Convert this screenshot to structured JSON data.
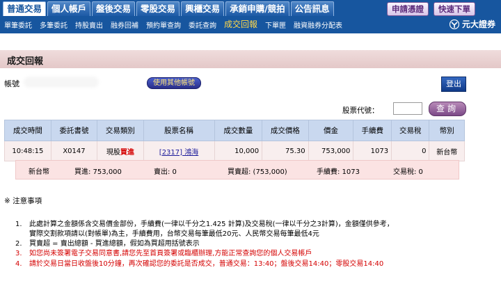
{
  "nav": {
    "tabs": [
      "普通交易",
      "個人帳戶",
      "盤後交易",
      "零股交易",
      "興櫃交易",
      "承銷申購/競拍",
      "公告訊息"
    ],
    "active_tab": 0,
    "apply_cert": "申請憑證",
    "quick_order": "快速下單",
    "subnav": [
      "單筆委託",
      "多筆委託",
      "持股賣出",
      "融券回補",
      "預約單查詢",
      "委託查詢",
      "成交回報",
      "下單匣",
      "融資融券分配表"
    ],
    "active_sub": 6,
    "brand": "元大證券"
  },
  "page": {
    "title": "成交回報",
    "account_label": "帳號",
    "other_account": "使用其他帳號",
    "logout": "登出",
    "stock_code_label": "股票代號：",
    "stock_code_value": "",
    "query": "查詢"
  },
  "table": {
    "headers": [
      "成交時間",
      "委託書號",
      "交易類別",
      "股票名稱",
      "成交數量",
      "成交價格",
      "價金",
      "手續費",
      "交易稅",
      "幣別"
    ],
    "rows": [
      {
        "time": "10:48:15",
        "order_no": "X0147",
        "type_prefix": "現股",
        "type_action": "買進",
        "stock": "[2317] 鴻海",
        "qty": "10,000",
        "price": "75.30",
        "amount": "753,000",
        "fee": "1073",
        "tax": "0",
        "currency": "新台幣"
      }
    ]
  },
  "summary": {
    "currency": "新台幣",
    "buy": "買進: 753,000",
    "sell": "賣出: 0",
    "net": "買賣超: (753,000)",
    "fee": "手續費: 1073",
    "tax": "交易稅: 0"
  },
  "notes": {
    "title": "※ 注意事項",
    "items": [
      {
        "num": "1.",
        "text": "此處計算之金額係含交易價金部份，手續費(一律以千分之1.425 計算)及交易稅(一律以千分之3計算)，金額僅供參考，"
      },
      {
        "num": "",
        "text": "實際交割款項請以(對帳單)為主，手續費用，台幣交易每筆最低20元、人民幣交易每筆最低4元"
      },
      {
        "num": "2.",
        "text": "買賣超 = 賣出總額 - 買進總額，假如為買超用括號表示"
      },
      {
        "num": "3.",
        "text": "如您尚未簽署電子交易同意書,請您先至首頁簽署或臨櫃辦理,方能正常查詢您的個人交易帳戶"
      },
      {
        "num": "4.",
        "text": "請於交易日當日收盤後10分鐘，再次確認您的委託是否成交，普通交易：13:40；盤後交易14:40；零股交易14:40"
      }
    ]
  },
  "colors": {
    "nav_bg": "#17569f",
    "title_band": "#e8cfcf",
    "header": "#c9d8ef",
    "row": "#f8eeee",
    "alert": "#d40000"
  }
}
